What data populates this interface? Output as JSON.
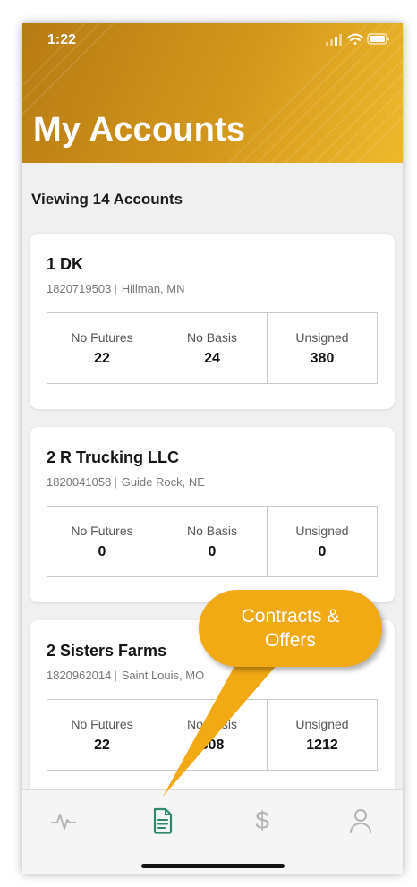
{
  "status_bar": {
    "time": "1:22"
  },
  "header": {
    "title": "My Accounts"
  },
  "viewing_label": "Viewing 14 Accounts",
  "accounts": [
    {
      "name": "1 DK",
      "account_number": "1820719503",
      "location": "Hillman, MN",
      "stats": [
        {
          "label": "No Futures",
          "value": "22"
        },
        {
          "label": "No Basis",
          "value": "24"
        },
        {
          "label": "Unsigned",
          "value": "380"
        }
      ]
    },
    {
      "name": "2 R Trucking LLC",
      "account_number": "1820041058",
      "location": "Guide Rock, NE",
      "stats": [
        {
          "label": "No Futures",
          "value": "0"
        },
        {
          "label": "No Basis",
          "value": "0"
        },
        {
          "label": "Unsigned",
          "value": "0"
        }
      ]
    },
    {
      "name": "2 Sisters Farms",
      "account_number": "1820962014",
      "location": "Saint Louis, MO",
      "stats": [
        {
          "label": "No Futures",
          "value": "22"
        },
        {
          "label": "No Basis",
          "value": "508"
        },
        {
          "label": "Unsigned",
          "value": "1212"
        }
      ]
    }
  ],
  "callout": {
    "text": "Contracts & Offers"
  },
  "tabbar": {
    "tabs": [
      {
        "icon": "activity-icon"
      },
      {
        "icon": "document-icon",
        "active": true
      },
      {
        "icon": "dollar-icon",
        "glyph": "$"
      },
      {
        "icon": "profile-icon"
      }
    ]
  },
  "colors": {
    "header_gold": "#d3971c",
    "callout_orange": "#f1a914",
    "active_tab": "#2e8a6b",
    "inactive_tab": "#b4b4b4"
  }
}
